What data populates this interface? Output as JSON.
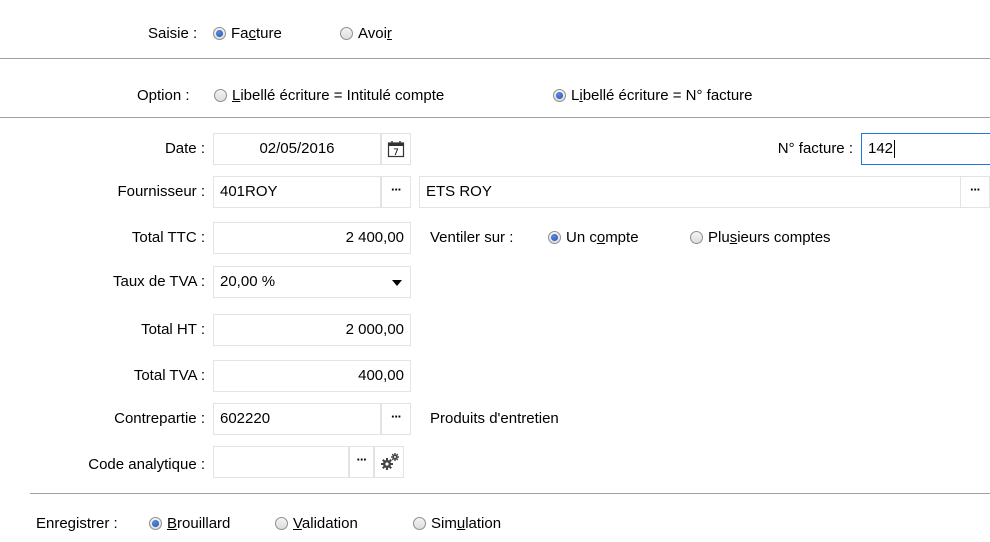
{
  "saisie": {
    "label": "Saisie :",
    "opt1_pre": "Fa",
    "opt1_ul": "c",
    "opt1_post": "ture",
    "opt2_pre": "Avoi",
    "opt2_ul": "r",
    "opt2_post": ""
  },
  "option": {
    "label": "Option :",
    "opt1_pre": "",
    "opt1_ul": "L",
    "opt1_post": "ibellé écriture = Intitulé compte",
    "opt2_pre": "L",
    "opt2_ul": "i",
    "opt2_post": "bellé écriture = N° facture"
  },
  "date": {
    "label": "Date :",
    "value": "02/05/2016",
    "calendar_day": "7"
  },
  "invoice_number": {
    "label": "N° facture :",
    "value": "142"
  },
  "supplier": {
    "label": "Fournisseur :",
    "code": "401ROY",
    "name": "ETS ROY"
  },
  "total_ttc": {
    "label": "Total TTC :",
    "value": "2 400,00"
  },
  "ventiler": {
    "label": "Ventiler sur :",
    "opt1_pre": "Un c",
    "opt1_ul": "o",
    "opt1_post": "mpte",
    "opt2_pre": "Plu",
    "opt2_ul": "s",
    "opt2_post": "ieurs comptes"
  },
  "tva_rate": {
    "label": "Taux de TVA :",
    "value": "20,00 %"
  },
  "total_ht": {
    "label": "Total HT :",
    "value": "2 000,00"
  },
  "total_tva": {
    "label": "Total TVA :",
    "value": "400,00"
  },
  "contrepartie": {
    "label": "Contrepartie :",
    "value": "602220",
    "description": "Produits d'entretien"
  },
  "code_analytique": {
    "label": "Code analytique :",
    "value": ""
  },
  "enregistrer": {
    "label": "Enregistrer :",
    "opt1_pre": "",
    "opt1_ul": "B",
    "opt1_post": "rouillard",
    "opt2_pre": "",
    "opt2_ul": "V",
    "opt2_post": "alidation",
    "opt3_pre": "Sim",
    "opt3_ul": "u",
    "opt3_post": "lation"
  },
  "ellipsis": "···",
  "colors": {
    "focus_border": "#1c7ad6",
    "radio_selected": "#1f4fb8"
  }
}
